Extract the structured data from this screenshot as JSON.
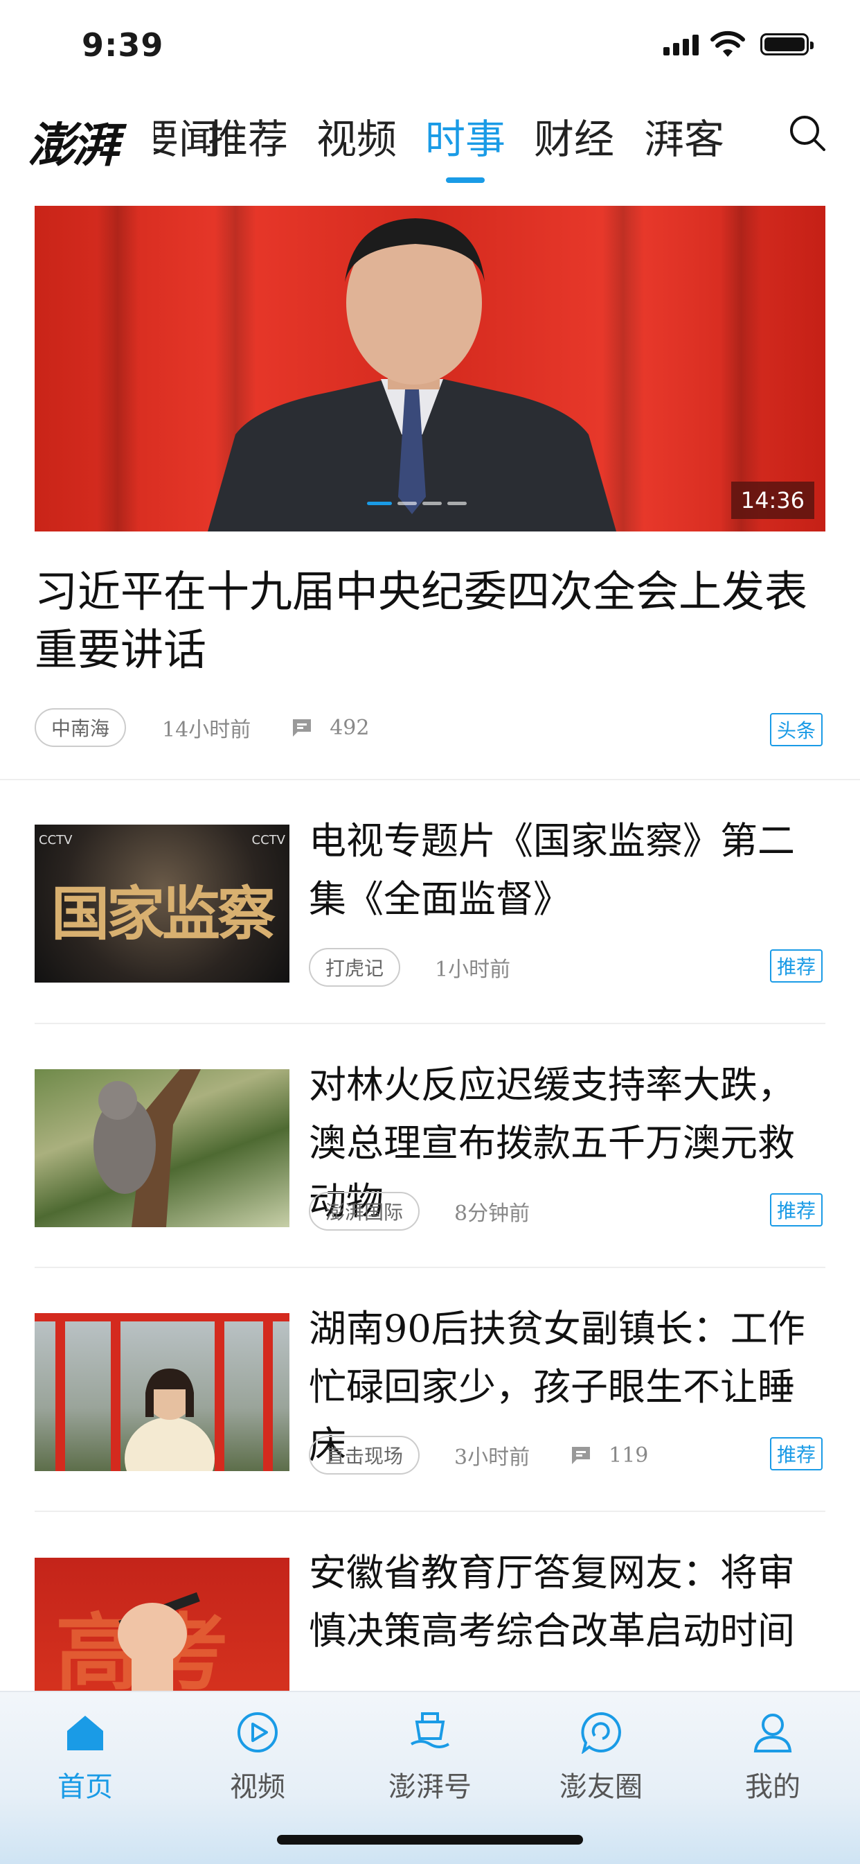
{
  "status_bar": {
    "time": "9:39"
  },
  "nav": {
    "logo": "澎湃",
    "clipped_tab": "要闻",
    "tabs": [
      "推荐",
      "视频",
      "时事",
      "财经",
      "湃客"
    ],
    "active_tab": "时事",
    "search_icon": "search-icon"
  },
  "hero": {
    "duration": "14:36",
    "title": "习近平在十九届中央纪委四次全会上发表重要讲话",
    "source": "中南海",
    "time": "14小时前",
    "comments": "492",
    "badge": "头条"
  },
  "news": [
    {
      "title": "电视专题片《国家监察》第二集《全面监督》",
      "source": "打虎记",
      "time": "1小时前",
      "comments": "",
      "badge": "推荐",
      "thumb_text": "国家监察"
    },
    {
      "title": "对林火反应迟缓支持率大跌，澳总理宣布拨款五千万澳元救动物",
      "source": "澎湃国际",
      "time": "8分钟前",
      "comments": "",
      "badge": "推荐",
      "thumb_text": ""
    },
    {
      "title": "湖南90后扶贫女副镇长：工作忙碌回家少，孩子眼生不让睡床",
      "source": "直击现场",
      "time": "3小时前",
      "comments": "119",
      "badge": "推荐",
      "thumb_text": ""
    },
    {
      "title": "安徽省教育厅答复网友：将审慎决策高考综合改革启动时间",
      "source": "",
      "time": "",
      "comments": "",
      "badge": "",
      "thumb_text": "高考"
    }
  ],
  "tabbar": {
    "items": [
      {
        "label": "首页",
        "icon": "home-icon"
      },
      {
        "label": "视频",
        "icon": "play-icon"
      },
      {
        "label": "澎湃号",
        "icon": "ship-icon"
      },
      {
        "label": "澎友圈",
        "icon": "chat-bubble-icon"
      },
      {
        "label": "我的",
        "icon": "person-icon"
      }
    ],
    "active": "首页"
  },
  "colors": {
    "accent": "#1a9be6",
    "text": "#111111",
    "meta": "#888888"
  }
}
